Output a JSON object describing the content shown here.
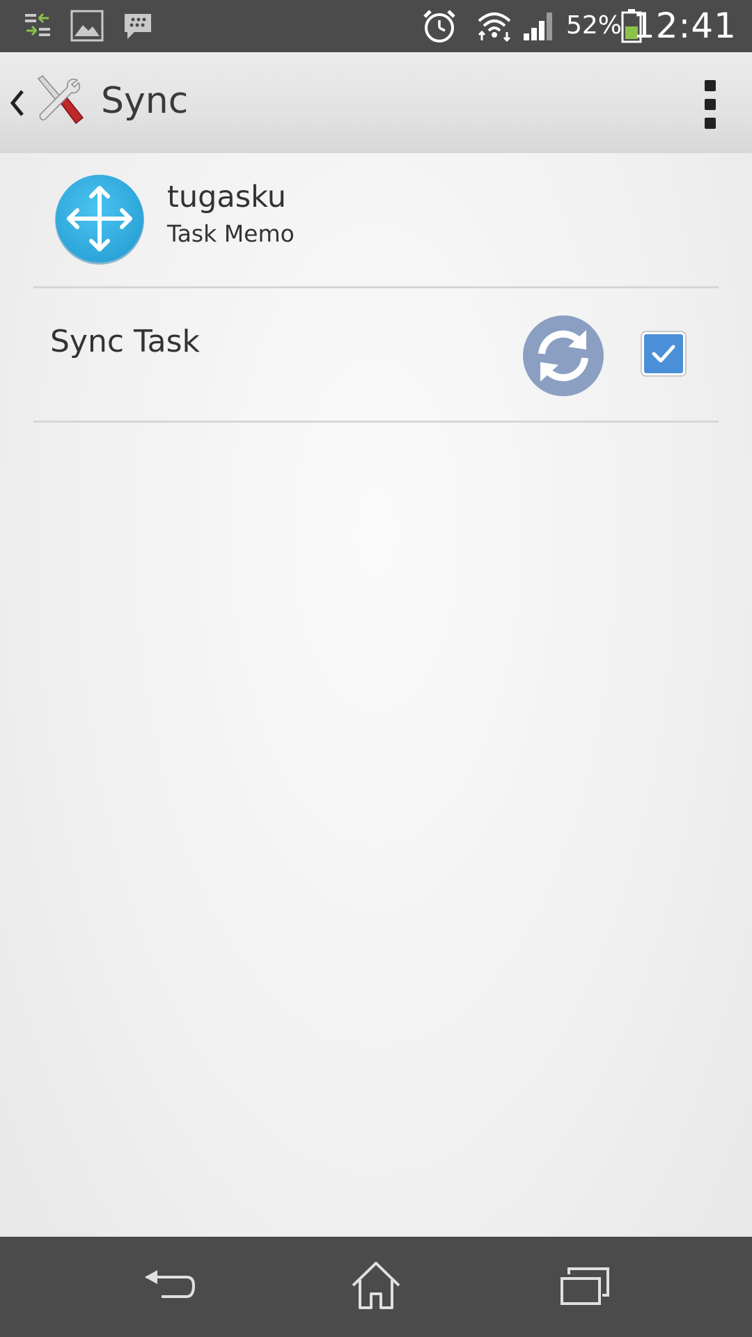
{
  "status_bar": {
    "battery_percent": "52%",
    "time": "12:41",
    "icons": [
      "transfer-icon",
      "image-notification-icon",
      "bbm-icon",
      "alarm-icon",
      "wifi-icon",
      "signal-icon",
      "battery-icon"
    ]
  },
  "action_bar": {
    "title": "Sync",
    "icon": "tools-icon",
    "menu_icon": "overflow-menu-icon"
  },
  "account": {
    "name": "tugasku",
    "type": "Task Memo",
    "icon": "move-arrows-icon",
    "icon_color": "#3bb3e6"
  },
  "sync_items": [
    {
      "label": "Sync Task",
      "checked": true,
      "icon": "sync-icon",
      "icon_color": "#8a9fc2"
    }
  ],
  "nav_bar": {
    "buttons": [
      "back-icon",
      "home-icon",
      "recent-apps-icon"
    ]
  },
  "colors": {
    "status_bar_bg": "#4b4b4b",
    "checkbox_blue": "#4a90d9"
  }
}
